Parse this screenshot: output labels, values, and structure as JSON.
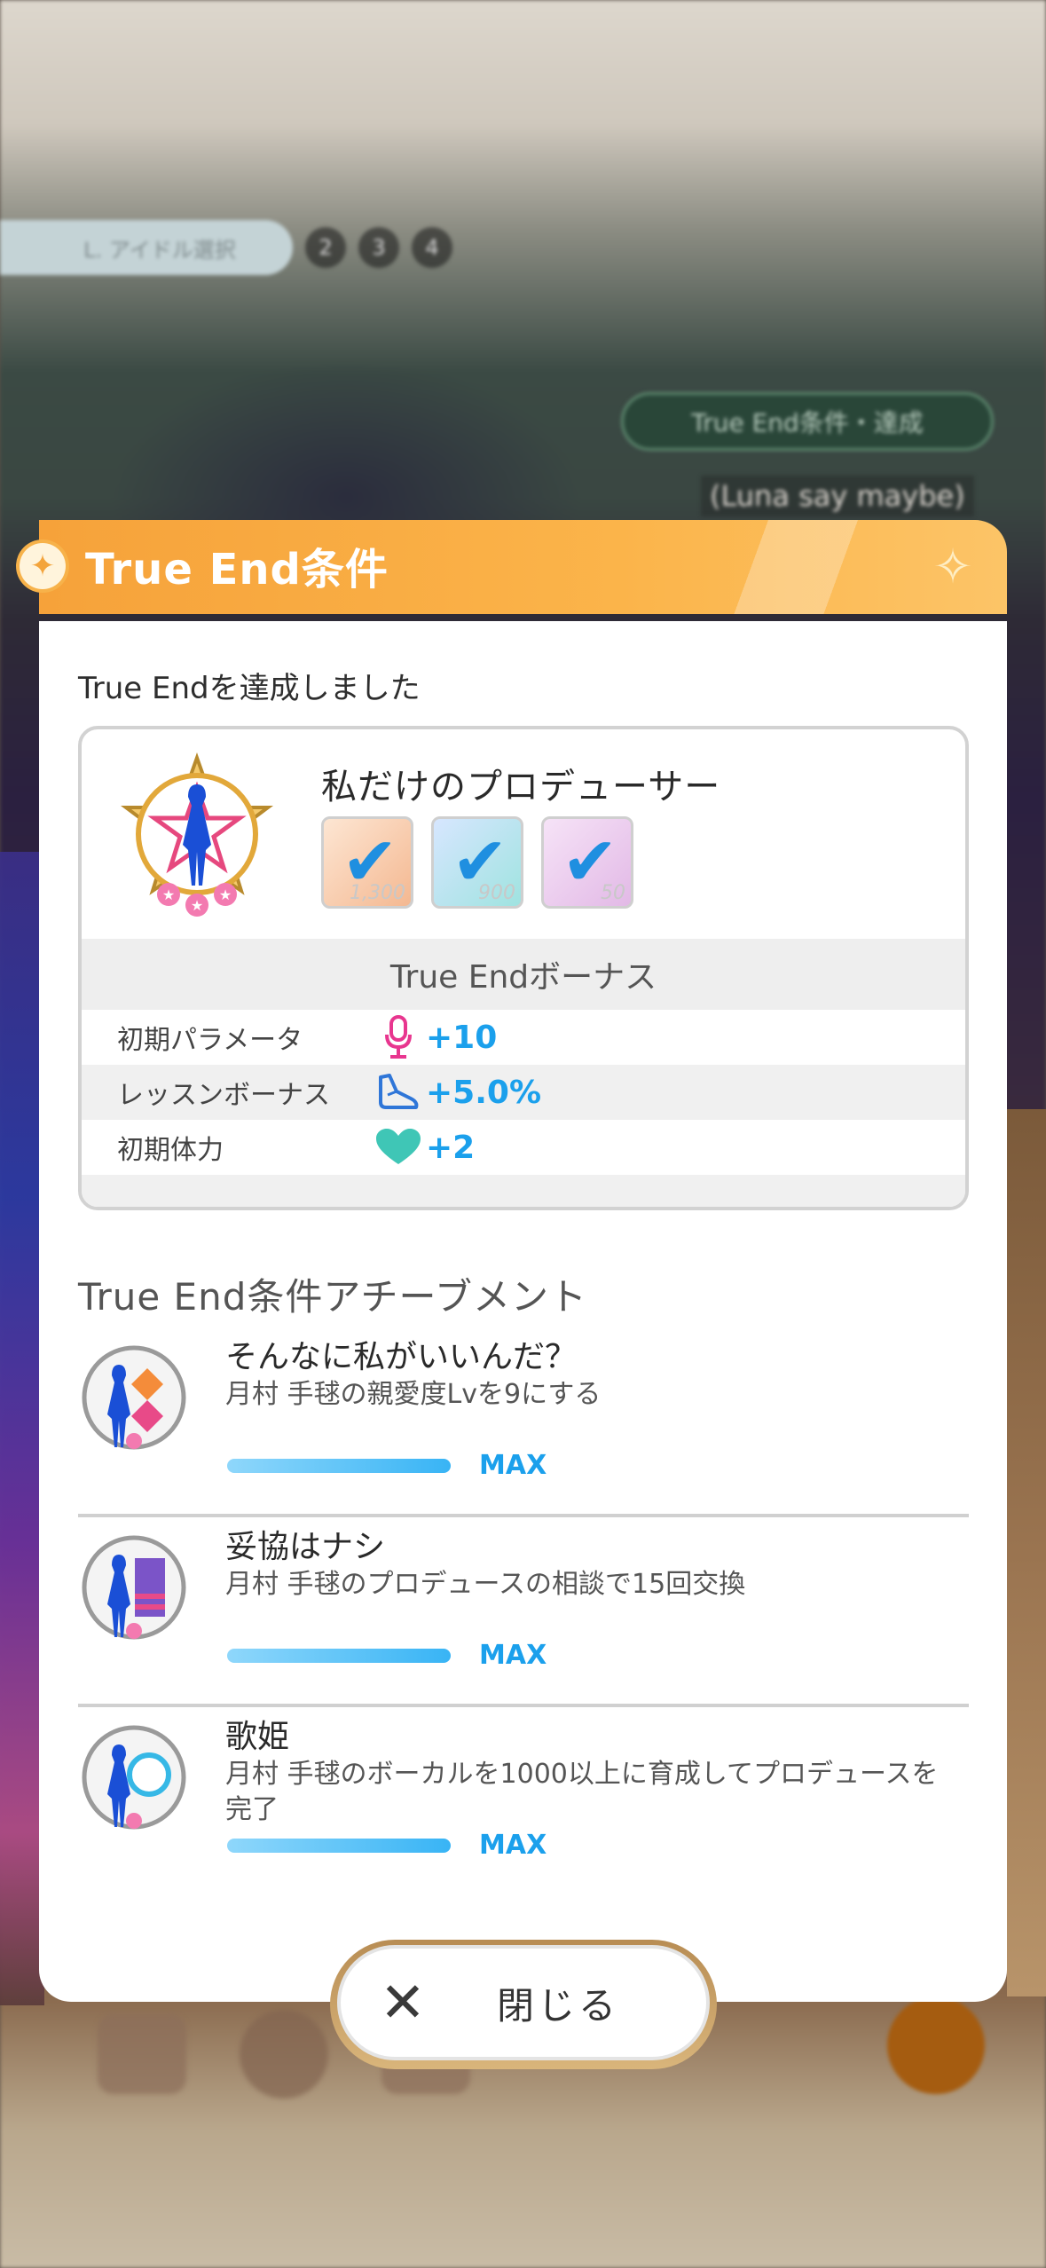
{
  "background": {
    "steps_pill": "L. アイドル選択",
    "steps": [
      "2",
      "3",
      "4"
    ],
    "chip_text": "True End条件・達成",
    "caption": "(Luna say maybe)"
  },
  "modal": {
    "title": "True End条件",
    "achieved_text": "True Endを達成しました",
    "card": {
      "title": "私だけのプロデューサー",
      "items": [
        {
          "icon": "gold-ticket-icon",
          "qty": "1,300",
          "checked": true
        },
        {
          "icon": "token-icon",
          "qty": "900",
          "checked": true
        },
        {
          "icon": "memory-piece-icon",
          "qty": "50",
          "checked": true
        }
      ],
      "bonus_heading": "True Endボーナス",
      "bonuses": [
        {
          "label": "初期パラメータ",
          "icon": "microphone-icon",
          "value": "+10"
        },
        {
          "label": "レッスンボーナス",
          "icon": "dance-shoe-icon",
          "value": "+5.0%"
        },
        {
          "label": "初期体力",
          "icon": "heart-icon",
          "value": "+2"
        }
      ]
    },
    "achievements_heading": "True End条件アチーブメント",
    "achievements": [
      {
        "title": "そんなに私がいいんだ？",
        "desc": "月村 手毬の親愛度Lvを9にする",
        "status": "MAX",
        "progress": 1.0
      },
      {
        "title": "妥協はナシ",
        "desc": "月村 手毬のプロデュースの相談で15回交換",
        "status": "MAX",
        "progress": 1.0
      },
      {
        "title": "歌姫",
        "desc": "月村 手毬のボーカルを1000以上に育成してプロデュースを完了",
        "status": "MAX",
        "progress": 1.0
      }
    ],
    "close_label": "閉じる"
  },
  "colors": {
    "header": "#f6a23a",
    "accent_blue": "#1ba0ec",
    "vocal_pink": "#e8368f",
    "heart_teal": "#3fc6b6"
  }
}
